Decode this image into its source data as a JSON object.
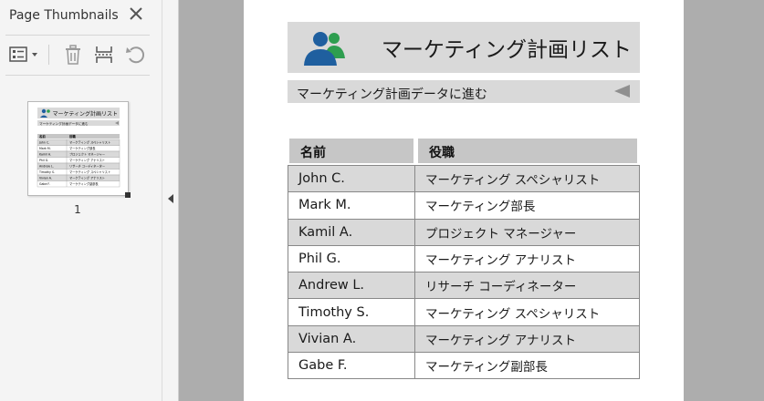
{
  "sidebar": {
    "title": "Page Thumbnails",
    "close_icon": "close-icon",
    "toolbar": [
      "options-icon",
      "delete-icon",
      "extract-pages-icon",
      "rotate-icon"
    ],
    "thumbnail": {
      "page_number": "1",
      "title": "マーケティング計画リスト",
      "link": "マーケティング計画データに進む",
      "headers": [
        "名前",
        "役職"
      ],
      "rows": [
        [
          "John C.",
          "マーケティング スペシャリスト"
        ],
        [
          "Mark M.",
          "マーケティング部長"
        ],
        [
          "Kamil A.",
          "プロジェクト マネージャー"
        ],
        [
          "Phil G.",
          "マーケティング アナリスト"
        ],
        [
          "Andrew L.",
          "リサーチ コーディネーター"
        ],
        [
          "Timothy S.",
          "マーケティング スペシャリスト"
        ],
        [
          "Vivian A.",
          "マーケティング アナリスト"
        ],
        [
          "Gabe F.",
          "マーケティング副部長"
        ]
      ]
    }
  },
  "document": {
    "header": {
      "icon": "people-group-icon",
      "title": "マーケティング計画リスト"
    },
    "nav": {
      "link_text": "マーケティング計画データに進む",
      "arrow_icon": "back-arrow-icon"
    },
    "table": {
      "headers": [
        "名前",
        "役職"
      ],
      "rows": [
        {
          "name": "John C.",
          "role": "マーケティング スペシャリスト"
        },
        {
          "name": "Mark M.",
          "role": "マーケティング部長"
        },
        {
          "name": "Kamil A.",
          "role": "プロジェクト マネージャー"
        },
        {
          "name": "Phil G.",
          "role": "マーケティング アナリスト"
        },
        {
          "name": "Andrew L.",
          "role": "リサーチ コーディネーター"
        },
        {
          "name": "Timothy S.",
          "role": "マーケティング スペシャリスト"
        },
        {
          "name": "Vivian A.",
          "role": "マーケティング アナリスト"
        },
        {
          "name": "Gabe F.",
          "role": "マーケティング副部長"
        }
      ]
    }
  },
  "colors": {
    "header_band": "#d9d9d9",
    "table_header": "#c6c6c6",
    "row_shaded": "#d9d9d9",
    "icon_blue": "#1f5f9f",
    "icon_green": "#2e9e4f",
    "canvas_gray": "#adadad"
  }
}
